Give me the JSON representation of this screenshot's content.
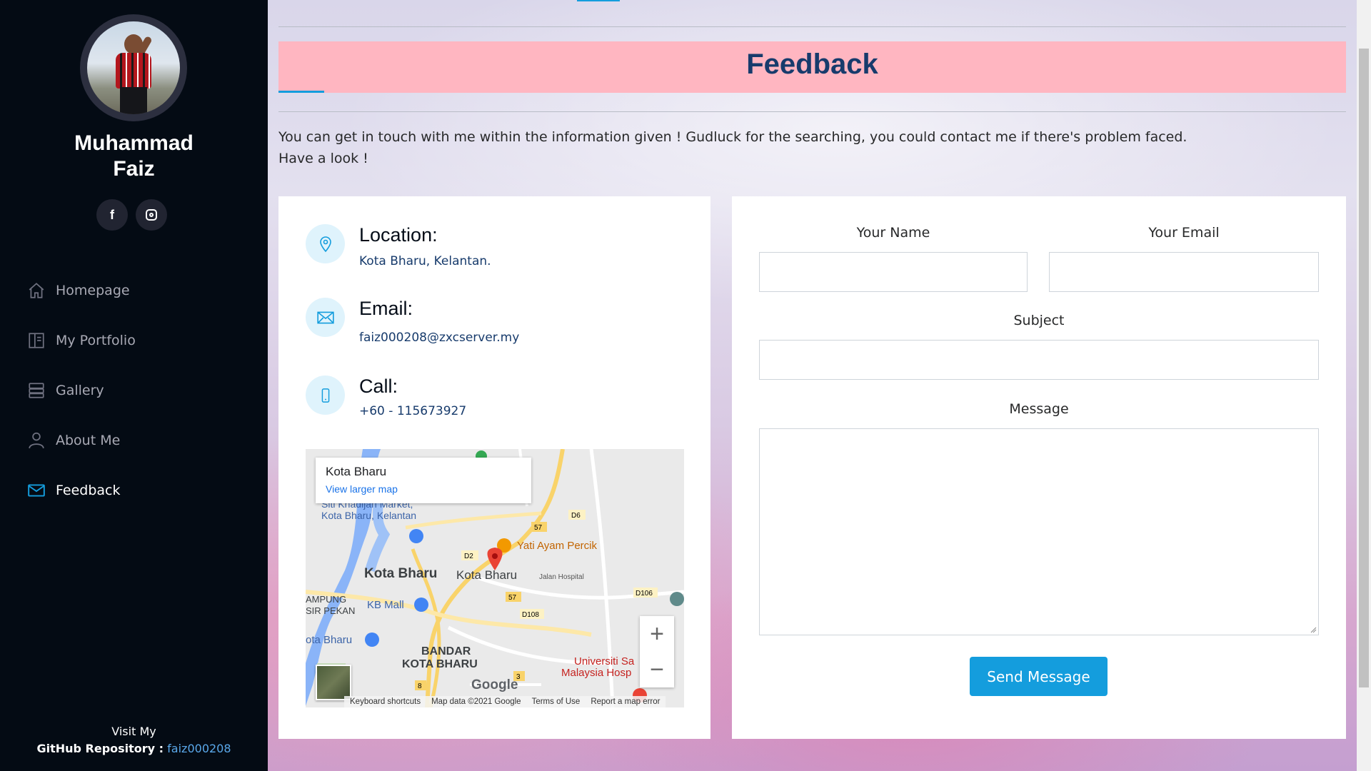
{
  "profile": {
    "name_line1": "Muhammad",
    "name_line2": "Faiz"
  },
  "social": [
    {
      "icon": "facebook-icon",
      "glyph": "f"
    },
    {
      "icon": "instagram-icon"
    }
  ],
  "nav": [
    {
      "label": "Homepage",
      "icon": "home-icon",
      "active": false
    },
    {
      "label": "My Portfolio",
      "icon": "book-icon",
      "active": false
    },
    {
      "label": "Gallery",
      "icon": "server-icon",
      "active": false
    },
    {
      "label": "About Me",
      "icon": "person-icon",
      "active": false
    },
    {
      "label": "Feedback",
      "icon": "envelope-icon",
      "active": true
    }
  ],
  "footer": {
    "line1": "Visit My",
    "line2_label": "GitHub Repository :",
    "line2_link": "faiz000208"
  },
  "page": {
    "title": "Feedback",
    "intro_line1": "You can get in touch with me within the information given ! Gudluck for the searching, you could contact me if there's problem faced.",
    "intro_line2": "Have a look !"
  },
  "info": {
    "location_title": "Location:",
    "location_value": "Kota Bharu, Kelantan.",
    "email_title": "Email:",
    "email_value": "faiz000208@zxcserver.my",
    "call_title": "Call:",
    "call_value": "+60 - 115673927"
  },
  "map": {
    "place": "Kota Bharu",
    "larger_link": "View larger map",
    "labels": {
      "market": "Siti Khadijah Market,",
      "market2": "Kota Bharu, Kelantan",
      "restaurant": "Yati Ayam Percik",
      "city_left": "Kota Bharu",
      "city_pin": "Kota Bharu",
      "hospital": "Jalan Hospital",
      "kampung": "AMPUNG",
      "sirpekan": "SIR PEKAN",
      "kbmall": "KB Mall",
      "kotabharu_small": "ota Bharu",
      "bandar": "BANDAR",
      "bandar2": "KOTA BHARU",
      "univ1": "Universiti Sa",
      "univ2": "Malaysia Hosp",
      "road_57": "57",
      "road_d6": "D6",
      "road_d2": "D2",
      "road_d108": "D108",
      "road_d106": "D106",
      "road_3": "3",
      "road_8": "8"
    },
    "google": "Google",
    "footer": [
      "Keyboard shortcuts",
      "Map data ©2021 Google",
      "Terms of Use",
      "Report a map error"
    ],
    "zoom_in": "+",
    "zoom_out": "−"
  },
  "form": {
    "name_label": "Your Name",
    "email_label": "Your Email",
    "subject_label": "Subject",
    "message_label": "Message",
    "submit_label": "Send Message"
  },
  "colors": {
    "accent": "#149ddd",
    "sidebar_bg": "#040b14",
    "banner_bg": "#ffb6c1",
    "title_color": "#173b6c"
  }
}
